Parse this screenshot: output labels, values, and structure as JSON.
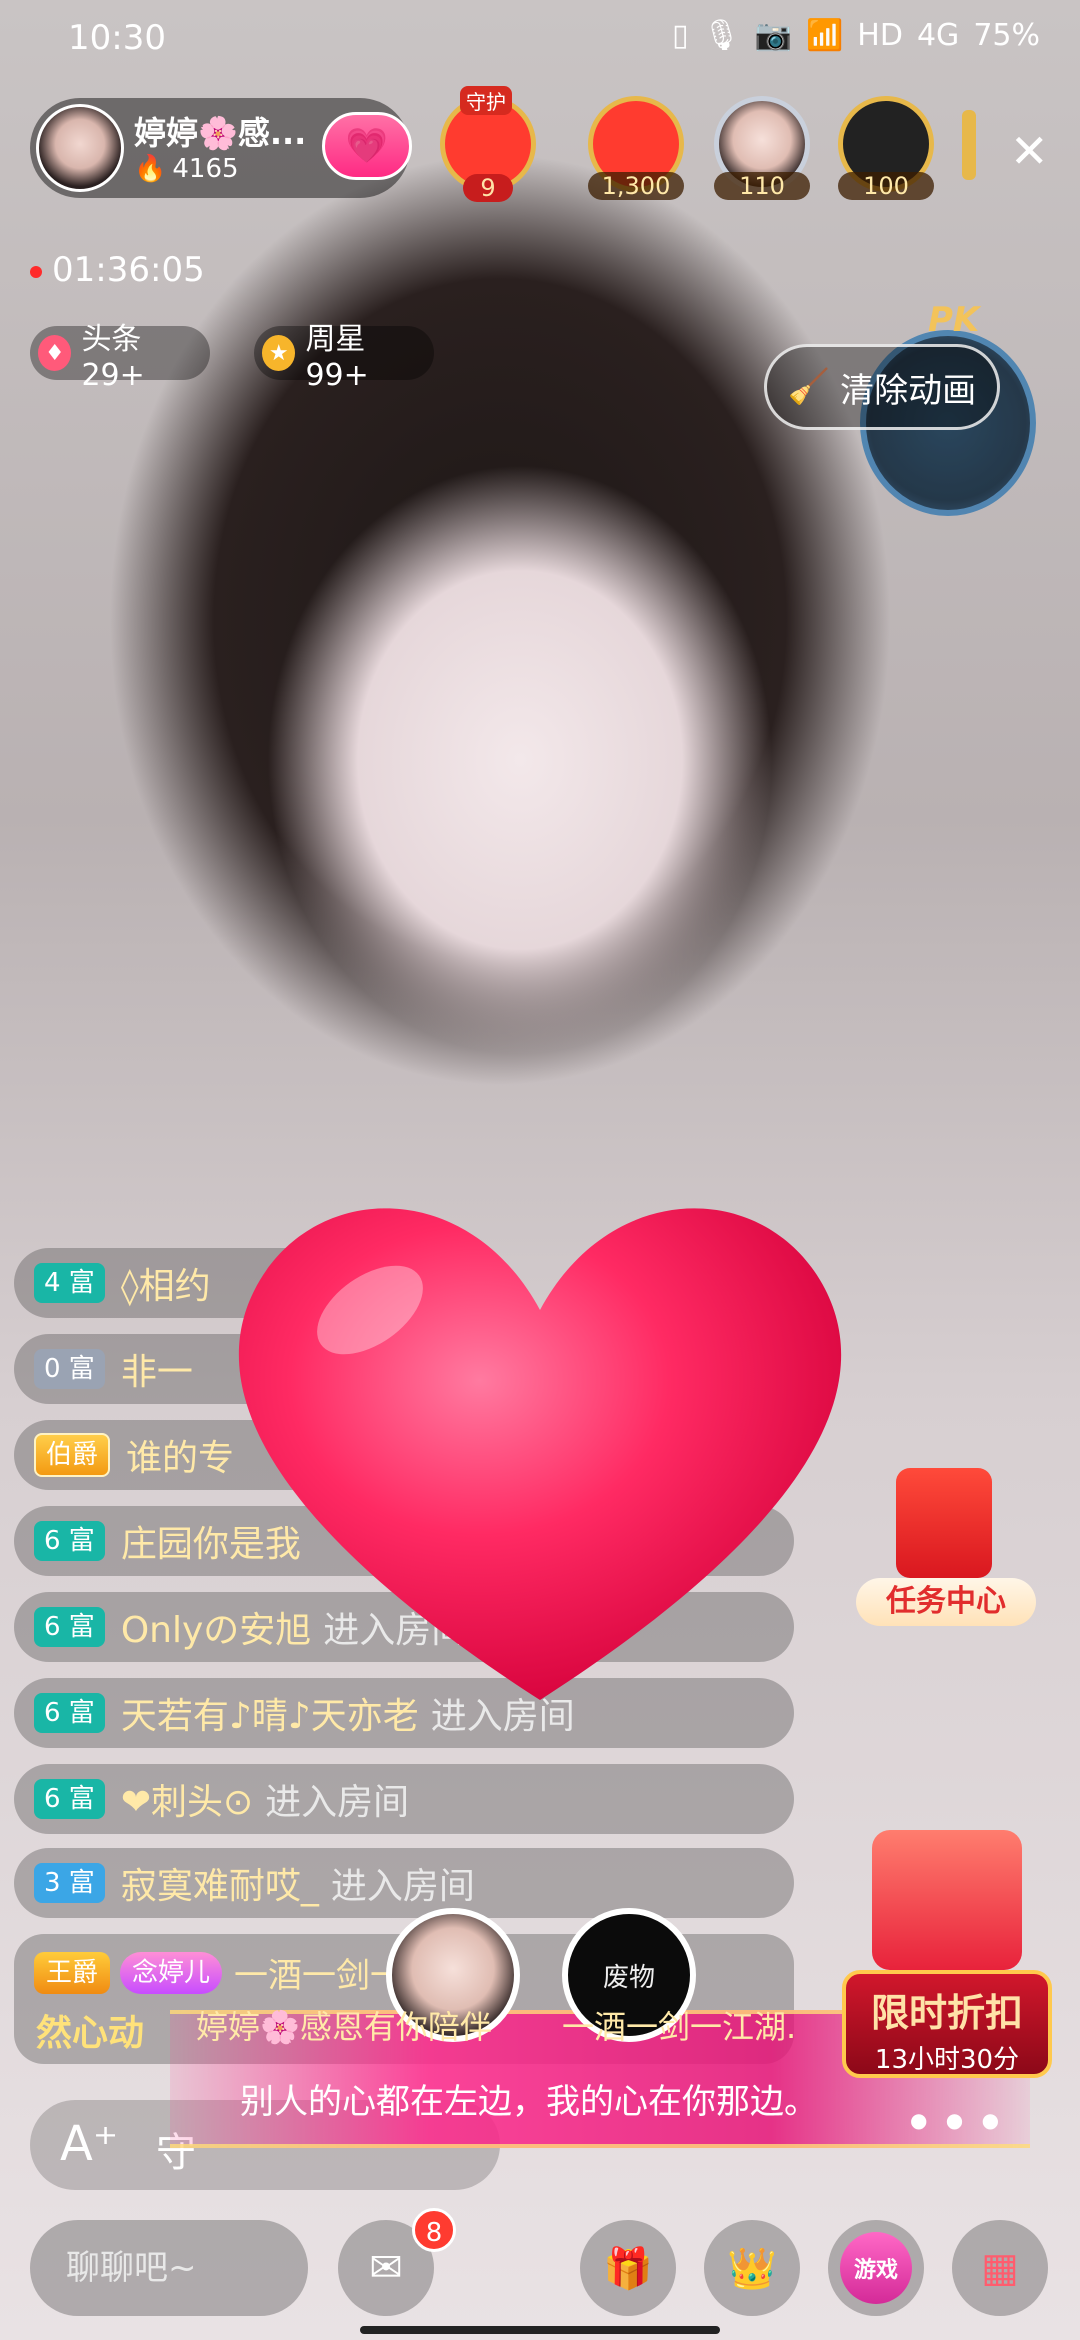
{
  "status": {
    "time": "10:30",
    "battery": "75%",
    "net": "4G",
    "hd": "HD"
  },
  "host": {
    "name": "婷婷🌸感...",
    "heat": "4165"
  },
  "viewers": [
    {
      "badge": "守护",
      "label": "9"
    },
    {
      "label": "1,300"
    },
    {
      "label": "110"
    },
    {
      "label": "100"
    }
  ],
  "live_timer": "01:36:05",
  "pills": {
    "headline": "头条29+",
    "weekstar": "周星99+"
  },
  "clear_anim": "清除动画",
  "pk": "PK",
  "chat": [
    {
      "level": "4 富",
      "name": "◊相约",
      "enter": ""
    },
    {
      "level": "0 富",
      "name": "非一",
      "enter": ""
    },
    {
      "level": "伯爵",
      "name": "谁的专",
      "enter": ""
    },
    {
      "level": "6 富",
      "name": "庄园你是我",
      "enter": ""
    },
    {
      "level": "6 富",
      "name": "Onlyの安旭",
      "enter": "进入房间"
    },
    {
      "level": "6 富",
      "name": "天若有♪晴♪天亦老",
      "enter": "进入房间"
    },
    {
      "level": "6 富",
      "name": "❤刺头⊙",
      "enter": "进入房间"
    },
    {
      "level": "3 富",
      "name": "寂寞难耐哎_",
      "enter": "进入房间"
    }
  ],
  "last_msg": {
    "badge": "王爵",
    "tag": "念婷儿",
    "text": "一酒一剑一江湖 怦",
    "text2": "然心动"
  },
  "banner": {
    "name1": "婷婷🌸感恩有你陪伴",
    "name2": "一酒一剑一江湖.",
    "av2": "废物",
    "line": "别人的心都在左边，我的心在你那边。"
  },
  "task_center": "任务中心",
  "sale": {
    "title": "限时折扣",
    "time": "13小时30分"
  },
  "bottom": {
    "placeholder": "聊聊吧~",
    "mail_count": "8",
    "game": "游戏"
  },
  "input": {
    "a": "A⁺",
    "shield": "守"
  }
}
